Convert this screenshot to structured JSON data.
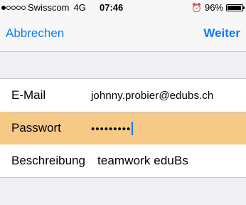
{
  "status_bar": {
    "signal_dots_filled": 1,
    "signal_dots_total": 5,
    "carrier": "Swisscom",
    "network": "4G",
    "time": "07:46",
    "alarm_icon": "alarm-clock-icon",
    "battery_percent": "96%",
    "battery_level": 0.96
  },
  "nav_bar": {
    "cancel_label": "Abbrechen",
    "next_label": "Weiter",
    "accent_color": "#0a7aff"
  },
  "form": {
    "email": {
      "label": "E-Mail",
      "value": "johnny.probier@edubs.ch"
    },
    "password": {
      "label": "Passwort",
      "value": "•••••••••",
      "highlight_color": "#f6c987"
    },
    "description": {
      "label": "Beschreibung",
      "value": "teamwork eduBs"
    }
  }
}
